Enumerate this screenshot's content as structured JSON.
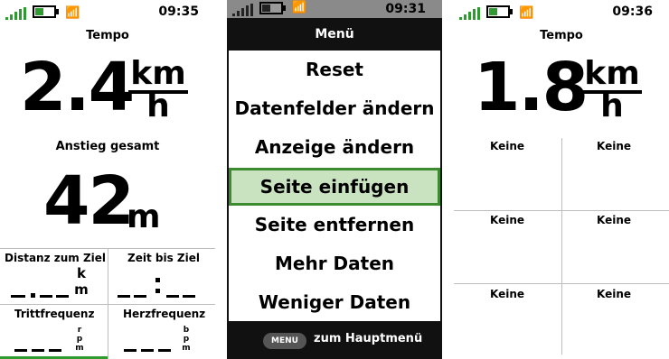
{
  "screens": [
    {
      "time": "09:35",
      "fields": {
        "speed": {
          "label": "Tempo",
          "value": "2.4",
          "unit_top": "km",
          "unit_bottom": "h"
        },
        "ascent": {
          "label": "Anstieg gesamt",
          "value": "42",
          "unit": "m"
        },
        "small": [
          {
            "label": "Distanz zum Ziel",
            "unit_top": "k",
            "unit_bottom": "m"
          },
          {
            "label": "Zeit bis Ziel"
          },
          {
            "label": "Trittfrequenz",
            "unit": [
              "r",
              "p",
              "m"
            ]
          },
          {
            "label": "Herzfrequenz",
            "unit": [
              "b",
              "p",
              "m"
            ]
          }
        ]
      },
      "page_progress": 0.5
    },
    {
      "time": "09:31",
      "title": "Menü",
      "items": [
        "Reset",
        "Datenfelder ändern",
        "Anzeige ändern",
        "Seite einfügen",
        "Seite entfernen",
        "Mehr Daten",
        "Weniger Daten"
      ],
      "selected_index": 3,
      "footer_key": "MENU",
      "footer_label": "zum Hauptmenü"
    },
    {
      "time": "09:36",
      "fields": {
        "speed": {
          "label": "Tempo",
          "value": "1.8",
          "unit_top": "km",
          "unit_bottom": "h"
        },
        "grid": [
          "Keine",
          "Keine",
          "Keine",
          "Keine",
          "Keine",
          "Keine"
        ]
      }
    }
  ],
  "colors": {
    "signal": "#2f9a2f",
    "selection_bg": "#c9e3c0",
    "selection_border": "#3d8b2f"
  }
}
